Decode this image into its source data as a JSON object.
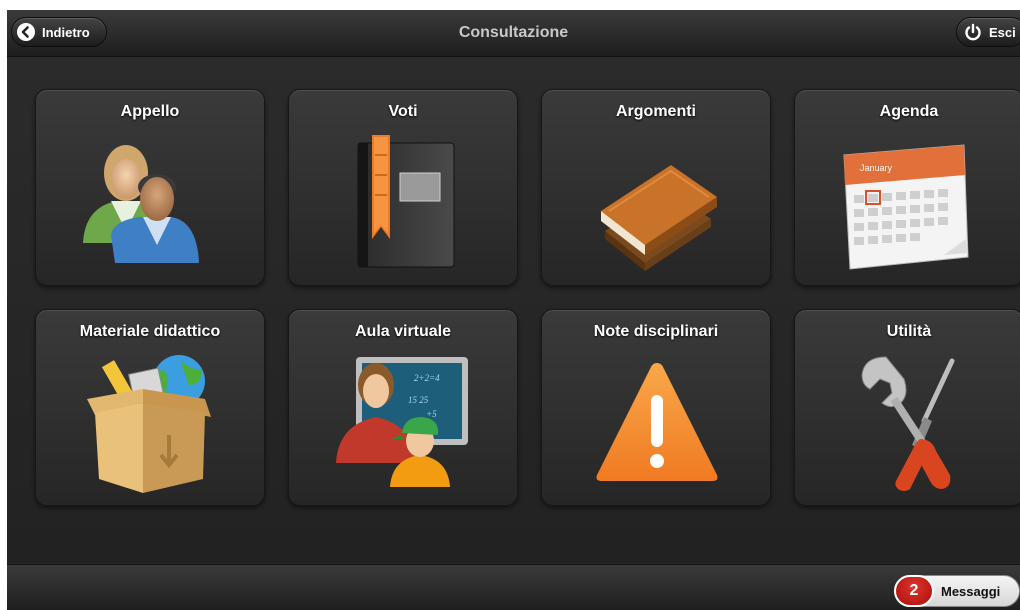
{
  "header": {
    "title": "Consultazione",
    "back_label": "Indietro",
    "exit_label": "Esci"
  },
  "tiles": [
    {
      "label": "Appello",
      "icon": "users-icon"
    },
    {
      "label": "Voti",
      "icon": "gradebook-icon"
    },
    {
      "label": "Argomenti",
      "icon": "books-icon"
    },
    {
      "label": "Agenda",
      "icon": "calendar-icon"
    },
    {
      "label": "Materiale didattico",
      "icon": "box-icon"
    },
    {
      "label": "Aula virtuale",
      "icon": "classroom-icon"
    },
    {
      "label": "Note disciplinari",
      "icon": "warning-icon"
    },
    {
      "label": "Utilità",
      "icon": "tools-icon"
    }
  ],
  "calendar": {
    "month": "January"
  },
  "footer": {
    "messages_count": "2",
    "messages_label": "Messaggi"
  },
  "colors": {
    "background": "#262626",
    "header": "#2a2a2a",
    "badge": "#c81d1a",
    "accent_orange": "#f07a22"
  }
}
